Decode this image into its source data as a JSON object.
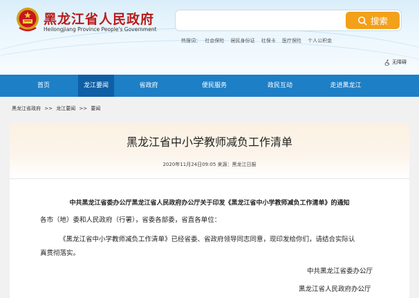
{
  "header": {
    "title": "黑龙江省人民政府",
    "subtitle": "Heilongjiang Province People's Government",
    "search": {
      "placeholder": "",
      "button_label": "搜索"
    },
    "hot_words": {
      "label": "热搜词：",
      "items": [
        "社会保险",
        "居民身份证",
        "社保卡",
        "医疗保险",
        "个人公积金"
      ]
    },
    "accessibility_label": "无障碍"
  },
  "nav": {
    "items": [
      {
        "label": "首页"
      },
      {
        "label": "龙江要闻"
      },
      {
        "label": "省政府"
      },
      {
        "label": "便民服务"
      },
      {
        "label": "政民互动"
      },
      {
        "label": "走进黑龙江"
      }
    ],
    "active_index": 1
  },
  "breadcrumb": {
    "items": [
      "黑龙江省政府",
      ">>",
      "龙江要闻",
      ">>",
      "要闻"
    ]
  },
  "article": {
    "title": "黑龙江省中小学教师减负工作清单",
    "date": "2020年11月24日09:05",
    "source": "来源：黑龙江日报",
    "notice_title": "中共黑龙江省委办公厅黑龙江省人民政府办公厅关于印发《黑龙江省中小学教师减负工作清单》的通知",
    "addressee": "各市（地）委和人民政府（行署），省委各部委，省直各单位：",
    "body_line1": "《黑龙江省中小学教师减负工作清单》已经省委、省政府领导同志同意，现印发给你们，请结合实际认",
    "body_line2": "真贯彻落实。",
    "signature1": "中共黑龙江省委办公厅",
    "signature2": "黑龙江省人民政府办公厅"
  },
  "colors": {
    "brand_red": "#b91a1a",
    "nav_blue": "#1d7fc6",
    "nav_active": "#0e5fa6",
    "search_orange": "#f3a01b"
  }
}
